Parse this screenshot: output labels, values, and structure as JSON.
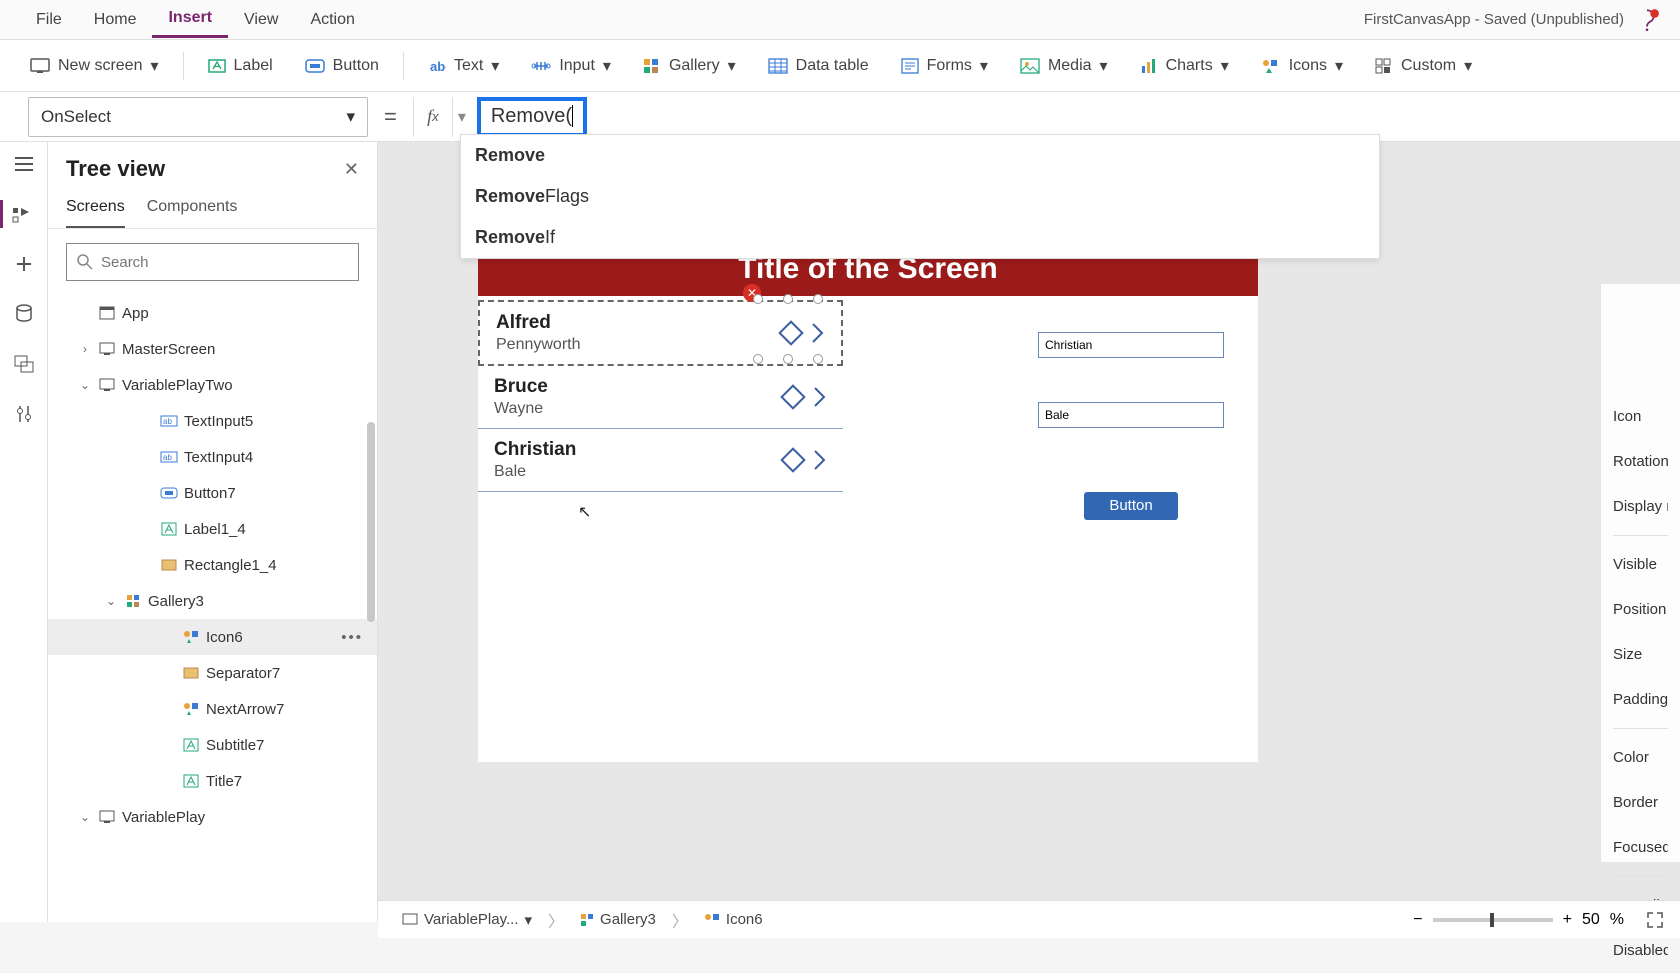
{
  "menubar": {
    "items": [
      "File",
      "Home",
      "Insert",
      "View",
      "Action"
    ],
    "active_index": 2,
    "app_title": "FirstCanvasApp - Saved (Unpublished)"
  },
  "ribbon": {
    "new_screen": "New screen",
    "label": "Label",
    "button": "Button",
    "text": "Text",
    "input": "Input",
    "gallery": "Gallery",
    "data_table": "Data table",
    "forms": "Forms",
    "media": "Media",
    "charts": "Charts",
    "icons": "Icons",
    "custom": "Custom"
  },
  "formula": {
    "property": "OnSelect",
    "text": "Remove(",
    "autocomplete": [
      {
        "match": "Remove",
        "rest": ""
      },
      {
        "match": "Remove",
        "rest": "Flags"
      },
      {
        "match": "Remove",
        "rest": "If"
      }
    ]
  },
  "tree": {
    "title": "Tree view",
    "tabs": [
      "Screens",
      "Components"
    ],
    "active_tab": 0,
    "search_placeholder": "Search",
    "items": [
      {
        "label": "App",
        "indent": 1,
        "icon": "app",
        "chev": ""
      },
      {
        "label": "MasterScreen",
        "indent": 1,
        "icon": "screen",
        "chev": ">"
      },
      {
        "label": "VariablePlayTwo",
        "indent": 1,
        "icon": "screen",
        "chev": "v"
      },
      {
        "label": "TextInput5",
        "indent": 3,
        "icon": "textinput",
        "chev": ""
      },
      {
        "label": "TextInput4",
        "indent": 3,
        "icon": "textinput",
        "chev": ""
      },
      {
        "label": "Button7",
        "indent": 3,
        "icon": "button",
        "chev": ""
      },
      {
        "label": "Label1_4",
        "indent": 3,
        "icon": "label",
        "chev": ""
      },
      {
        "label": "Rectangle1_4",
        "indent": 3,
        "icon": "rect",
        "chev": ""
      },
      {
        "label": "Gallery3",
        "indent": 2,
        "icon": "gallery",
        "chev": "v"
      },
      {
        "label": "Icon6",
        "indent": 4,
        "icon": "icons",
        "chev": "",
        "selected": true
      },
      {
        "label": "Separator7",
        "indent": 4,
        "icon": "rect",
        "chev": ""
      },
      {
        "label": "NextArrow7",
        "indent": 4,
        "icon": "icons",
        "chev": ""
      },
      {
        "label": "Subtitle7",
        "indent": 4,
        "icon": "label",
        "chev": ""
      },
      {
        "label": "Title7",
        "indent": 4,
        "icon": "label",
        "chev": ""
      },
      {
        "label": "VariablePlay",
        "indent": 1,
        "icon": "screen",
        "chev": "v"
      }
    ]
  },
  "canvas": {
    "screen_title": "Title of the Screen",
    "gallery": [
      {
        "first": "Alfred",
        "last": "Pennyworth",
        "selected": true
      },
      {
        "first": "Bruce",
        "last": "Wayne",
        "selected": false
      },
      {
        "first": "Christian",
        "last": "Bale",
        "selected": false
      }
    ],
    "inputs": {
      "first": "Christian",
      "last": "Bale"
    },
    "button_label": "Button"
  },
  "right_pane": {
    "props": [
      "Icon",
      "Rotation",
      "Display mode",
      "",
      "Visible",
      "Position",
      "Size",
      "Padding",
      "",
      "Color",
      "Border",
      "Focused border",
      "",
      "Auto disable",
      "Disabled color"
    ]
  },
  "breadcrumb": {
    "items": [
      "VariablePlay...",
      "Gallery3",
      "Icon6"
    ],
    "zoom": "50",
    "zoom_unit": "%"
  }
}
